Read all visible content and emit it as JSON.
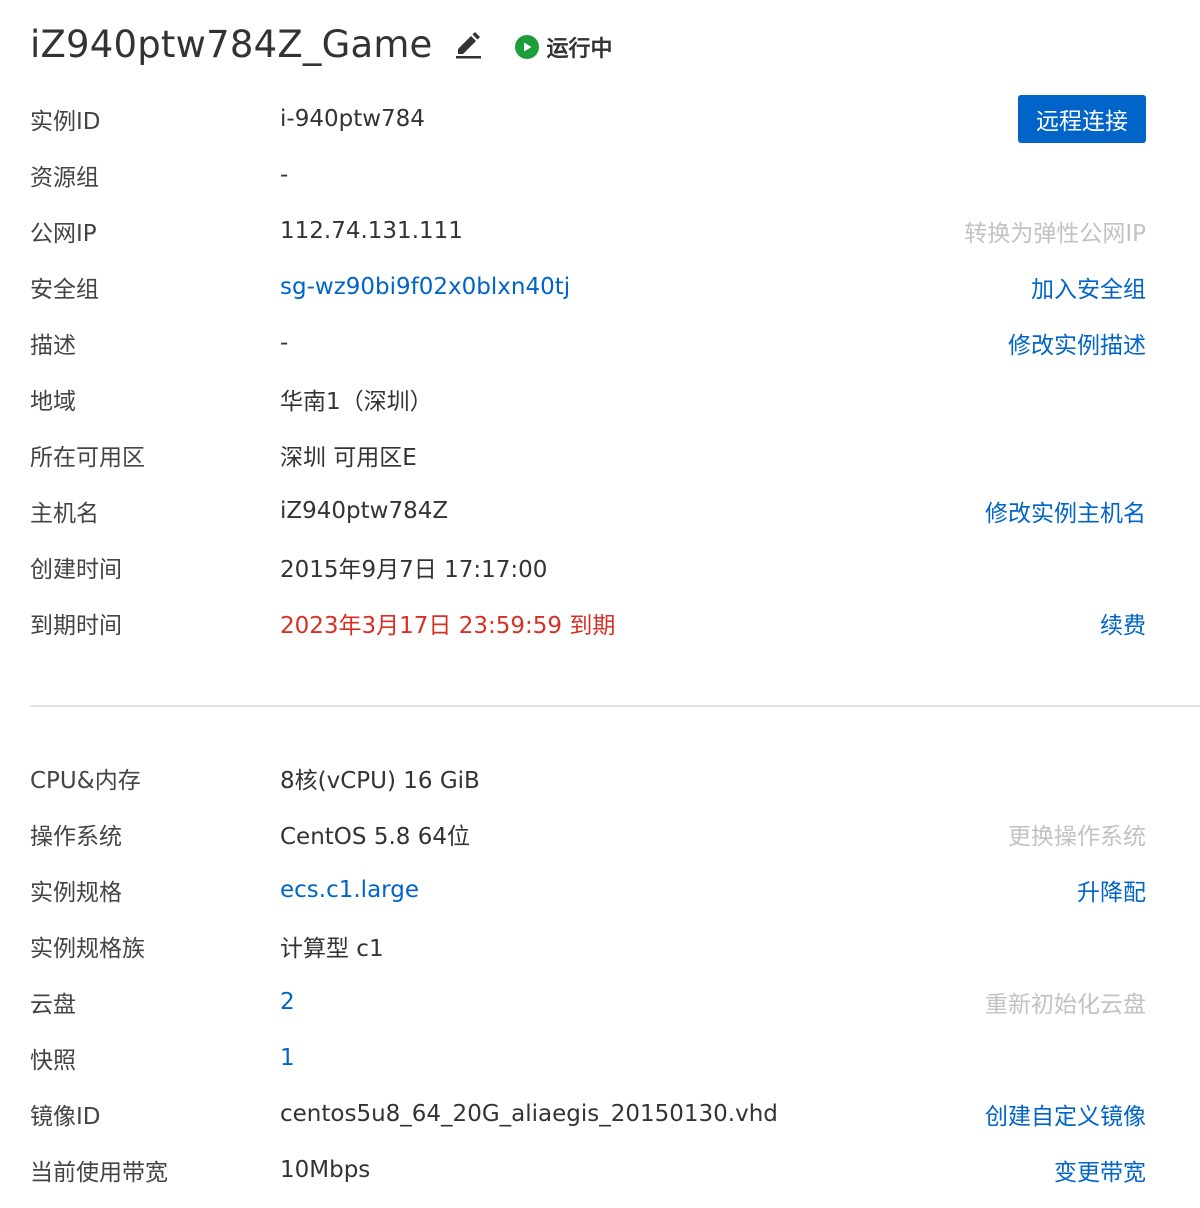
{
  "header": {
    "title": "iZ940ptw784Z_Game",
    "status": "运行中",
    "status_color": "#1e9e3a"
  },
  "basic_info": {
    "rows": [
      {
        "label": "实例ID",
        "value": "i-940ptw784",
        "action": "远程连接"
      },
      {
        "label": "资源组",
        "value": "-"
      },
      {
        "label": "公网IP",
        "value": "112.74.131.111",
        "action": "转换为弹性公网IP"
      },
      {
        "label": "安全组",
        "value": "sg-wz90bi9f02x0blxn40tj",
        "action": "加入安全组"
      },
      {
        "label": "描述",
        "value": "-",
        "action": "修改实例描述"
      },
      {
        "label": "地域",
        "value": "华南1（深圳）"
      },
      {
        "label": "所在可用区",
        "value": "深圳 可用区E"
      },
      {
        "label": "主机名",
        "value": "iZ940ptw784Z",
        "action": "修改实例主机名"
      },
      {
        "label": "创建时间",
        "value": "2015年9月7日 17:17:00"
      },
      {
        "label": "到期时间",
        "value": "2023年3月17日 23:59:59 到期",
        "action": "续费"
      }
    ]
  },
  "config_info": {
    "rows": [
      {
        "label": "CPU&内存",
        "value": "8核(vCPU) 16 GiB"
      },
      {
        "label": "操作系统",
        "value": "CentOS 5.8 64位",
        "action": "更换操作系统"
      },
      {
        "label": "实例规格",
        "value": "ecs.c1.large",
        "action": "升降配"
      },
      {
        "label": "实例规格族",
        "value": "计算型 c1"
      },
      {
        "label": "云盘",
        "value": "2",
        "action": "重新初始化云盘"
      },
      {
        "label": "快照",
        "value": "1"
      },
      {
        "label": "镜像ID",
        "value": "centos5u8_64_20G_aliaegis_20150130.vhd",
        "action": "创建自定义镜像"
      },
      {
        "label": "当前使用带宽",
        "value": "10Mbps",
        "action": "变更带宽"
      }
    ]
  },
  "colors": {
    "primary": "#0064c8",
    "danger": "#d93026",
    "disabled": "#c2c2c2"
  }
}
